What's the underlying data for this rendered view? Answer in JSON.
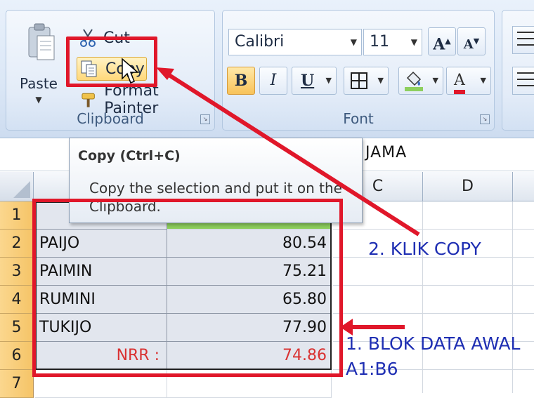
{
  "ribbon": {
    "clipboard": {
      "label": "Clipboard",
      "paste_label": "Paste",
      "cut_label": "Cut",
      "copy_label": "Copy",
      "format_painter_label": "Format Painter"
    },
    "font": {
      "label": "Font",
      "font_name": "Calibri",
      "font_size": "11",
      "grow_label": "A",
      "shrink_label": "A",
      "bold_label": "B",
      "italic_label": "I",
      "underline_label": "U",
      "font_color_label": "A"
    }
  },
  "formula_bar": {
    "content": "JAMA"
  },
  "tooltip": {
    "title": "Copy (Ctrl+C)",
    "body": "Copy the selection and put it on the Clipboard."
  },
  "sheet": {
    "column_headers": [
      "C",
      "D"
    ],
    "row_headers": [
      "1",
      "2",
      "3",
      "4",
      "5",
      "6",
      "7"
    ],
    "rows": [
      {
        "name": "PAIJO",
        "value": "80.54"
      },
      {
        "name": "PAIMIN",
        "value": "75.21"
      },
      {
        "name": "RUMINI",
        "value": "65.80"
      },
      {
        "name": "TUKIJO",
        "value": "77.90"
      }
    ],
    "summary": {
      "label": "NRR :",
      "value": "74.86"
    }
  },
  "annotations": {
    "step2": "2. KLIK COPY",
    "step1_line1": "1. BLOK DATA AWAL",
    "step1_line2": "A1:B6"
  },
  "colors": {
    "annotation_red": "#e0172a",
    "annotation_blue": "#1f2fb3",
    "nrr_red": "#d93232"
  }
}
